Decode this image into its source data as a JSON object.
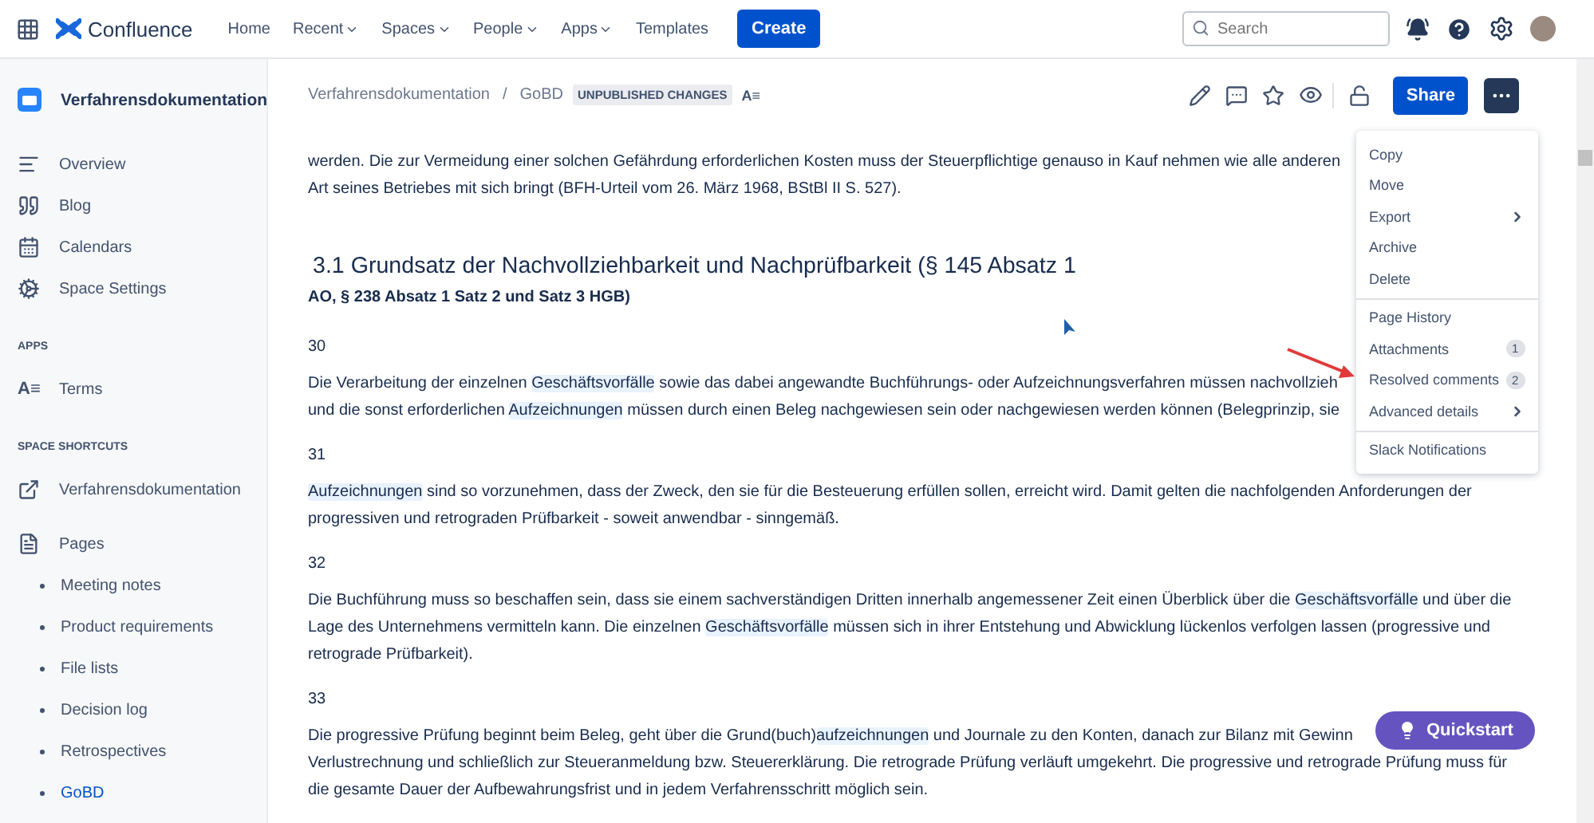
{
  "topbar": {
    "product": "Confluence",
    "nav": [
      {
        "label": "Home",
        "dropdown": false
      },
      {
        "label": "Recent",
        "dropdown": true
      },
      {
        "label": "Spaces",
        "dropdown": true
      },
      {
        "label": "People",
        "dropdown": true
      },
      {
        "label": "Apps",
        "dropdown": true
      },
      {
        "label": "Templates",
        "dropdown": false
      }
    ],
    "create": "Create",
    "search": {
      "placeholder": "Search"
    }
  },
  "sidebar": {
    "space": "Verfahrensdokumentation",
    "items": [
      {
        "label": "Overview"
      },
      {
        "label": "Blog"
      },
      {
        "label": "Calendars"
      },
      {
        "label": "Space Settings"
      }
    ],
    "apps_heading": "APPS",
    "apps": [
      {
        "icon_text": "A≡",
        "label": "Terms"
      }
    ],
    "shortcuts_heading": "SPACE SHORTCUTS",
    "shortcuts": [
      {
        "label": "Verfahrensdokumentation"
      }
    ],
    "pages_label": "Pages",
    "pages": [
      {
        "label": "Meeting notes",
        "selected": false
      },
      {
        "label": "Product requirements",
        "selected": false
      },
      {
        "label": "File lists",
        "selected": false
      },
      {
        "label": "Decision log",
        "selected": false
      },
      {
        "label": "Retrospectives",
        "selected": false
      },
      {
        "label": "GoBD",
        "selected": true
      }
    ]
  },
  "header": {
    "breadcrumbs": [
      "Verfahrensdokumentation",
      "GoBD"
    ],
    "separator": "/",
    "badge": "UNPUBLISHED CHANGES",
    "glossary_icon_text": "A≡",
    "share": "Share"
  },
  "content": [
    {
      "kind": "paragraph",
      "lines": [
        [
          {
            "text": "werden. Die zur Vermeidung einer solchen Gefährdung erforderlichen Kosten muss der Steuerpflichtige genauso in Kauf nehmen wie alle anderen",
            "term": false
          }
        ],
        [
          {
            "text": "Art seines Betriebes mit sich bringt (BFH-Urteil vom 26. März 1968, BStBl II S. 527).",
            "term": false
          }
        ]
      ]
    },
    {
      "kind": "heading",
      "text": "3.1 Grundsatz der Nachvollziehbarkeit und Nachprüfbarkeit (§ 145 Absatz 1"
    },
    {
      "kind": "subheading",
      "text": "AO, § 238 Absatz 1 Satz 2 und Satz 3 HGB)"
    },
    {
      "kind": "number",
      "text": "30"
    },
    {
      "kind": "paragraph",
      "lines": [
        [
          {
            "text": "Die Verarbeitung der einzelnen ",
            "term": false
          },
          {
            "text": "Geschäftsvorfälle",
            "term": true
          },
          {
            "text": " sowie das dabei angewandte Buchführungs- oder Aufzeichnungsverfahren müssen nachvollzieh",
            "term": false
          }
        ],
        [
          {
            "text": "und die sonst erforderlichen ",
            "term": false
          },
          {
            "text": "Aufzeichnungen",
            "term": true
          },
          {
            "text": " müssen durch einen Beleg nachgewiesen sein oder nachgewiesen werden können (Belegprinzip, sie",
            "term": false
          }
        ]
      ]
    },
    {
      "kind": "number",
      "text": "31"
    },
    {
      "kind": "paragraph",
      "lines": [
        [
          {
            "text": "Aufzeichnungen",
            "term": true
          },
          {
            "text": " sind so vorzunehmen, dass der Zweck, den sie für die Besteuerung erfüllen sollen, erreicht wird. Damit gelten die nachfolgenden Anforderungen der",
            "term": false
          }
        ],
        [
          {
            "text": "progressiven und retrograden Prüfbarkeit - soweit anwendbar - sinngemäß.",
            "term": false
          }
        ]
      ]
    },
    {
      "kind": "number",
      "text": "32"
    },
    {
      "kind": "paragraph",
      "lines": [
        [
          {
            "text": "Die Buchführung muss so beschaffen sein, dass sie einem sachverständigen Dritten innerhalb angemessener Zeit einen Überblick über die ",
            "term": false
          },
          {
            "text": "Geschäftsvorfälle",
            "term": true
          },
          {
            "text": " und über die",
            "term": false
          }
        ],
        [
          {
            "text": "Lage des Unternehmens vermitteln kann. Die einzelnen ",
            "term": false
          },
          {
            "text": "Geschäftsvorfälle",
            "term": true
          },
          {
            "text": " müssen sich in ihrer Entstehung und Abwicklung lückenlos verfolgen lassen (progressive und",
            "term": false
          }
        ],
        [
          {
            "text": "retrograde Prüfbarkeit).",
            "term": false
          }
        ]
      ]
    },
    {
      "kind": "number",
      "text": "33"
    },
    {
      "kind": "paragraph",
      "lines": [
        [
          {
            "text": "Die progressive Prüfung beginnt beim Beleg, geht über die Grund(buch)",
            "term": false
          },
          {
            "text": "aufzeichnungen",
            "term": true
          },
          {
            "text": " und Journale zu den Konten, danach zur Bilanz mit Gewinn",
            "term": false
          }
        ],
        [
          {
            "text": "Verlustrechnung und schließlich zur Steueranmeldung bzw. Steuererklärung. Die retrograde Prüfung verläuft umgekehrt. Die progressive und retrograde Prüfung muss für",
            "term": false
          }
        ],
        [
          {
            "text": "die gesamte Dauer der Aufbewahrungsfrist und in jedem Verfahrensschritt möglich sein.",
            "term": false
          }
        ]
      ]
    }
  ],
  "menu": {
    "groups": [
      [
        {
          "label": "Copy",
          "submenu": false
        },
        {
          "label": "Move",
          "submenu": false
        },
        {
          "label": "Export",
          "submenu": true
        },
        {
          "label": "Archive",
          "submenu": false
        },
        {
          "label": "Delete",
          "submenu": false
        }
      ],
      [
        {
          "label": "Page History",
          "submenu": false
        },
        {
          "label": "Attachments",
          "count": "1",
          "submenu": false
        },
        {
          "label": "Resolved comments",
          "count": "2",
          "submenu": false
        },
        {
          "label": "Advanced details",
          "submenu": true
        }
      ],
      [
        {
          "label": "Slack Notifications",
          "submenu": false
        }
      ]
    ]
  },
  "quickstart": "Quickstart"
}
